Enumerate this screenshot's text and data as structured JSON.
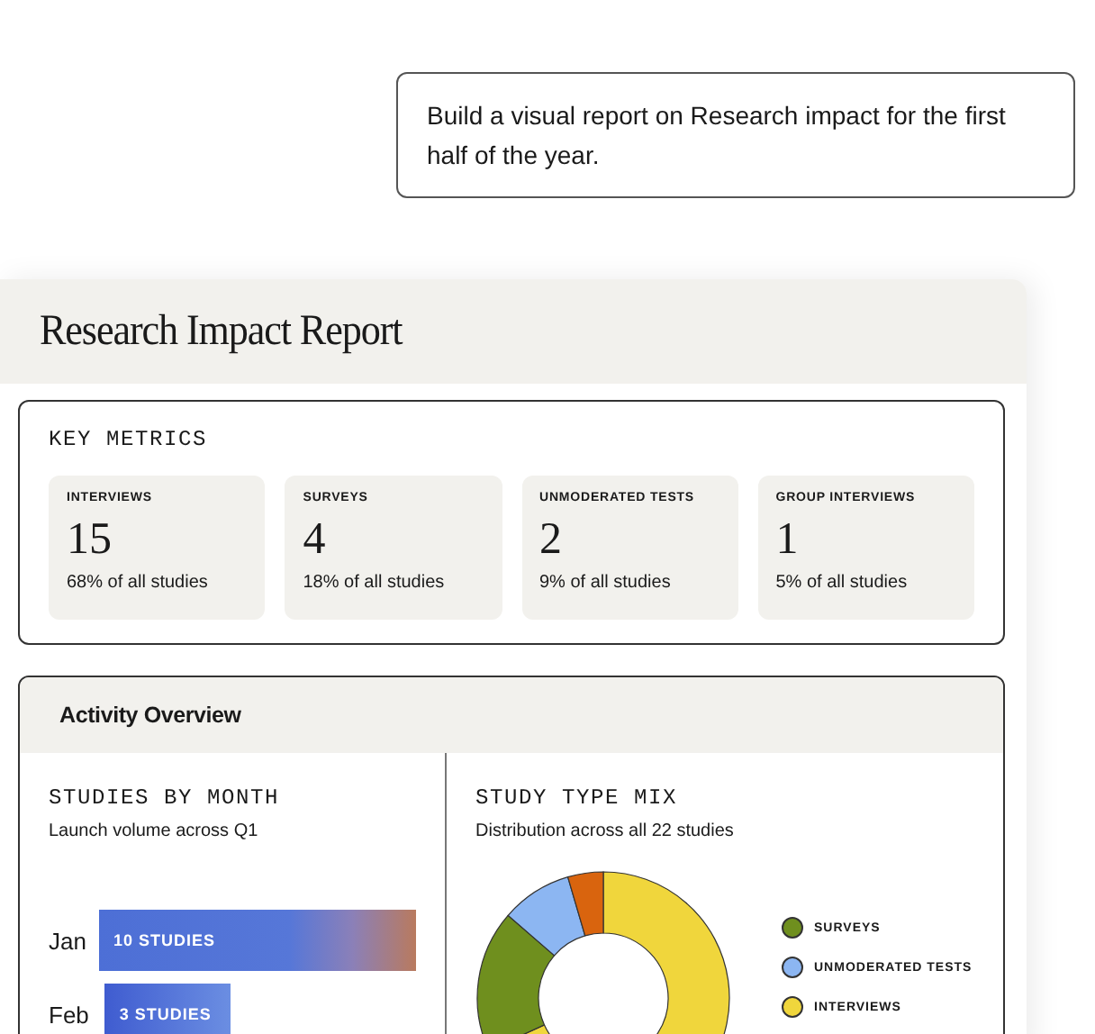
{
  "prompt": {
    "text": "Build a visual report on Research impact for the first half of the year."
  },
  "report": {
    "title": "Research Impact Report"
  },
  "key_metrics": {
    "heading": "KEY METRICS",
    "cards": [
      {
        "label": "INTERVIEWS",
        "value": "15",
        "share": "68% of all studies"
      },
      {
        "label": "SURVEYS",
        "value": "4",
        "share": "18% of all studies"
      },
      {
        "label": "UNMODERATED TESTS",
        "value": "2",
        "share": "9% of all studies"
      },
      {
        "label": "GROUP INTERVIEWS",
        "value": "1",
        "share": "5% of all studies"
      }
    ]
  },
  "activity_overview": {
    "title": "Activity Overview",
    "studies_by_month": {
      "heading": "STUDIES BY MONTH",
      "subtitle": "Launch volume across Q1",
      "bars": [
        {
          "month": "Jan",
          "label": "10 STUDIES"
        },
        {
          "month": "Feb",
          "label": "3 STUDIES"
        }
      ]
    },
    "study_type_mix": {
      "heading": "STUDY TYPE MIX",
      "subtitle": "Distribution across all 22 studies",
      "legend": [
        {
          "label": "SURVEYS",
          "color": "#6f8f1e"
        },
        {
          "label": "UNMODERATED TESTS",
          "color": "#8cb6f2"
        },
        {
          "label": "INTERVIEWS",
          "color": "#f0d63c"
        }
      ]
    }
  }
}
